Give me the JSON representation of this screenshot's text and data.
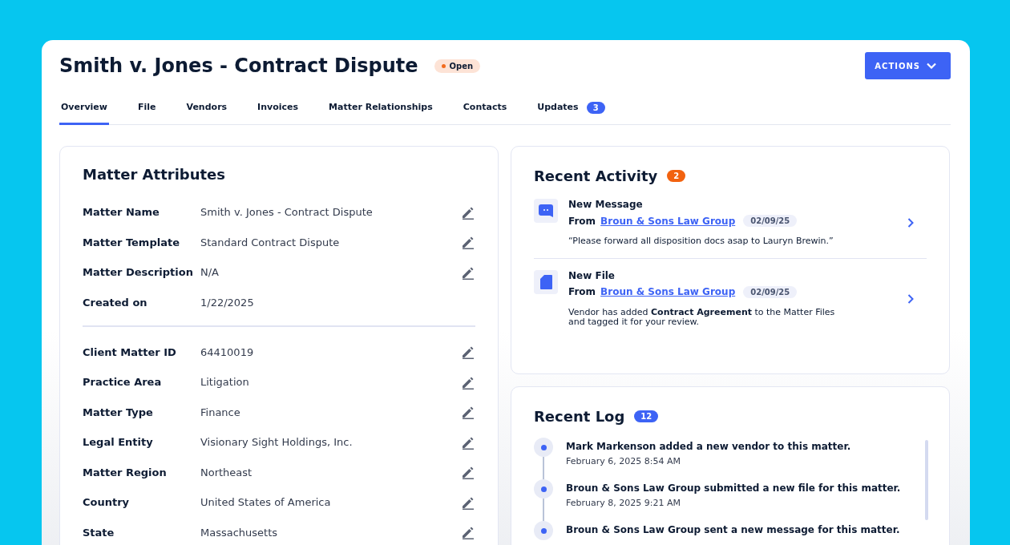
{
  "header": {
    "title": "Smith v. Jones - Contract Dispute",
    "status": {
      "label": "Open",
      "color": "#f26b1d"
    },
    "actions_button": "ACTIONS"
  },
  "tabs": [
    {
      "label": "Overview",
      "selected": true
    },
    {
      "label": "File",
      "selected": false
    },
    {
      "label": "Vendors",
      "selected": false
    },
    {
      "label": "Invoices",
      "selected": false
    },
    {
      "label": "Matter Relationships",
      "selected": false
    },
    {
      "label": "Contacts",
      "selected": false
    },
    {
      "label": "Updates",
      "selected": false,
      "badge": "3"
    }
  ],
  "matter_attributes": {
    "title": "Matter Attributes",
    "groups": [
      [
        {
          "label": "Matter Name",
          "value": "Smith v. Jones - Contract Dispute",
          "editable": true
        },
        {
          "label": "Matter Template",
          "value": "Standard Contract Dispute",
          "editable": true
        },
        {
          "label": "Matter Description",
          "value": "N/A",
          "editable": true
        },
        {
          "label": "Created on",
          "value": "1/22/2025",
          "editable": false
        }
      ],
      [
        {
          "label": "Client Matter ID",
          "value": "64410019",
          "editable": true
        },
        {
          "label": "Practice Area",
          "value": "Litigation",
          "editable": true
        },
        {
          "label": "Matter Type",
          "value": "Finance",
          "editable": true
        },
        {
          "label": "Legal Entity",
          "value": "Visionary Sight Holdings, Inc.",
          "editable": true
        },
        {
          "label": "Matter Region",
          "value": "Northeast",
          "editable": true
        },
        {
          "label": "Country",
          "value": "United States of America",
          "editable": true
        },
        {
          "label": "State",
          "value": "Massachusetts",
          "editable": true
        }
      ]
    ]
  },
  "recent_activity": {
    "title": "Recent Activity",
    "count": "2",
    "items": [
      {
        "kind": "message",
        "title": "New Message",
        "from_label": "From",
        "sender": "Broun & Sons Law Group",
        "date": "02/09/25",
        "body": "“Please forward all disposition docs asap to Lauryn Brewin.”"
      },
      {
        "kind": "file",
        "title": "New File",
        "from_label": "From",
        "sender": "Broun & Sons Law Group",
        "date": "02/09/25",
        "body": "Vendor has added **Contract Agreement** to the Matter Files and tagged it for your review."
      }
    ]
  },
  "recent_log": {
    "title": "Recent Log",
    "count": "12",
    "entries": [
      {
        "text": "Mark Markenson added a new vendor to this matter.",
        "time": "February 6, 2025 8:54 AM"
      },
      {
        "text": "Broun & Sons Law Group submitted a new file for this matter.",
        "time": "February 8, 2025 9:21 AM"
      },
      {
        "text": "Broun & Sons Law Group sent a new message for this matter."
      }
    ]
  }
}
